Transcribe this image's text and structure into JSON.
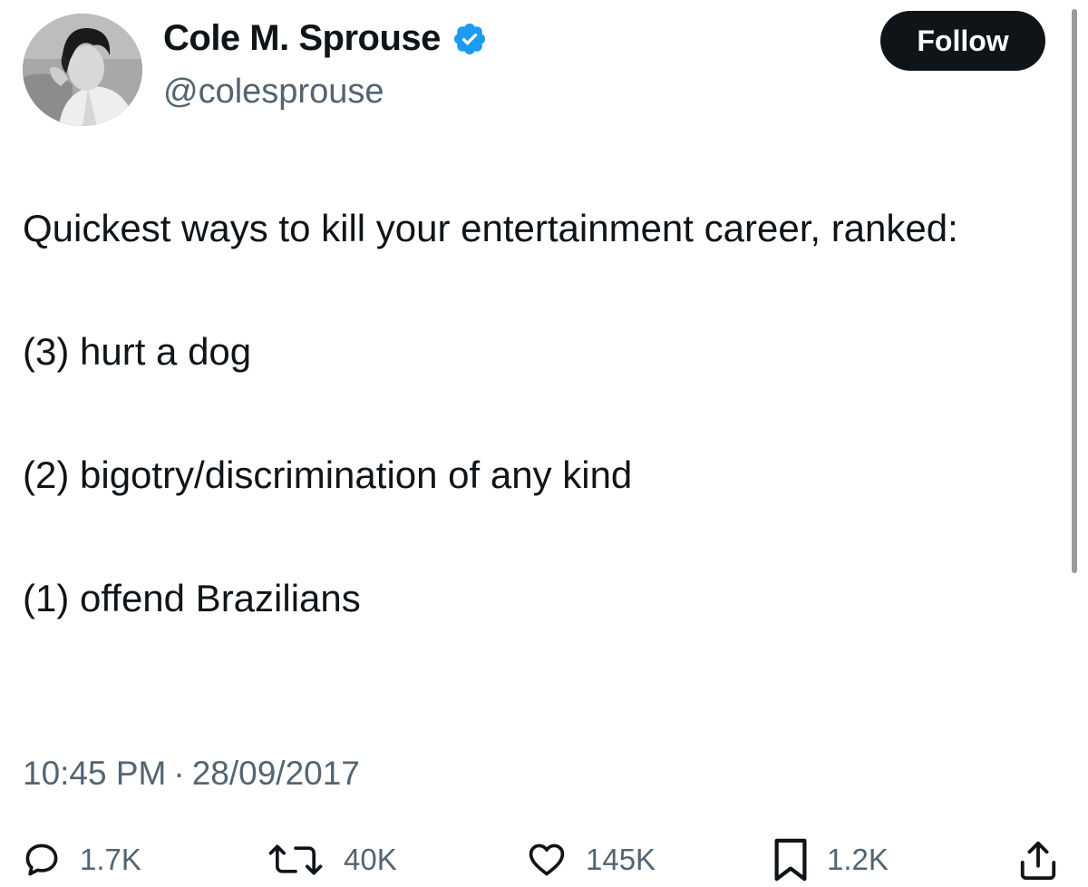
{
  "author": {
    "display_name": "Cole M. Sprouse",
    "handle": "@colesprouse",
    "verified_icon": "verified-badge-icon",
    "verified_color": "#1d9bf0"
  },
  "follow_label": "Follow",
  "tweet": {
    "lines": [
      "Quickest ways to kill your entertainment career, ranked:",
      "(3) hurt a dog",
      "(2) bigotry/discrimination of any kind",
      "(1) offend Brazilians"
    ]
  },
  "timestamp": {
    "time": "10:45 PM",
    "separator": "·",
    "date": "28/09/2017"
  },
  "actions": {
    "replies": {
      "icon": "reply-icon",
      "count": "1.7K"
    },
    "reposts": {
      "icon": "repost-icon",
      "count": "40K"
    },
    "likes": {
      "icon": "heart-icon",
      "count": "145K"
    },
    "bookmarks": {
      "icon": "bookmark-icon",
      "count": "1.2K"
    },
    "share": {
      "icon": "share-icon"
    }
  },
  "colors": {
    "text": "#0f1419",
    "secondary": "#536471",
    "button_bg": "#0f1419",
    "button_text": "#ffffff"
  }
}
